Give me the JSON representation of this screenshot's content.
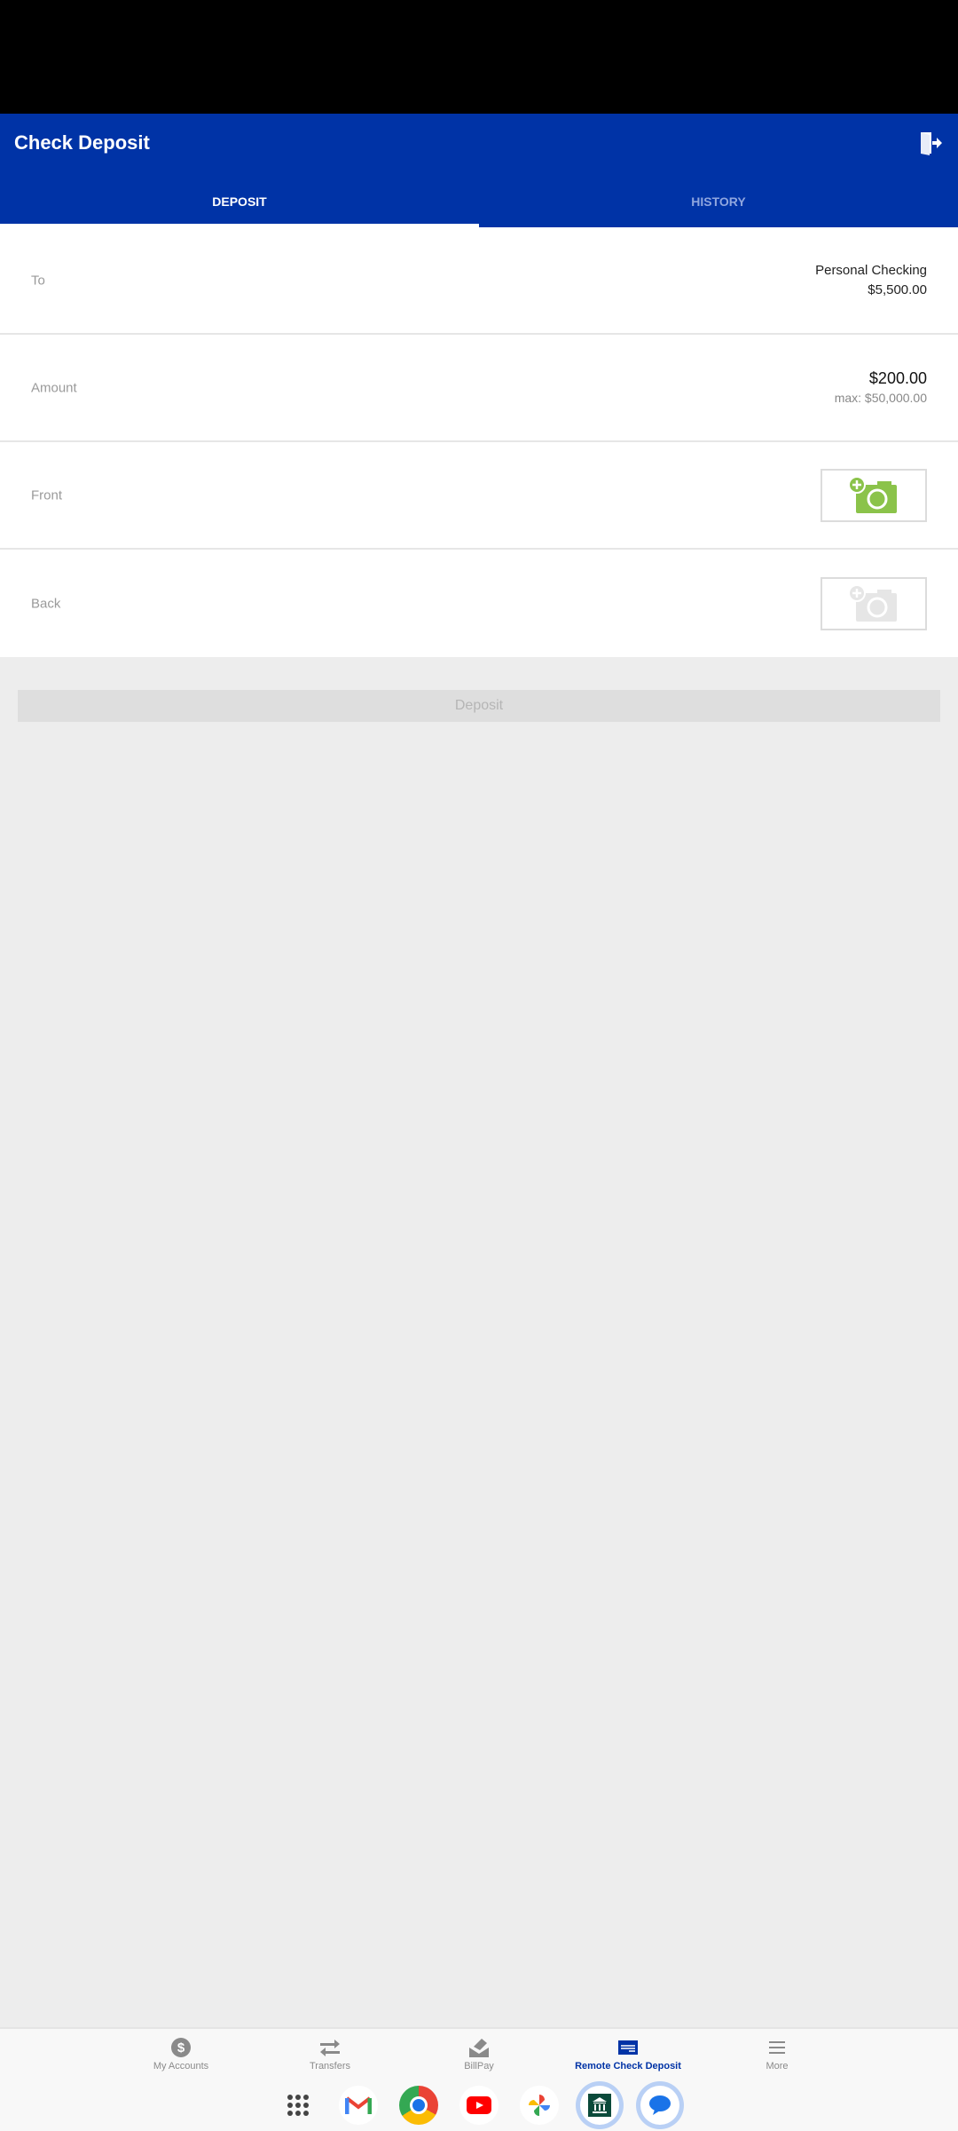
{
  "header": {
    "title": "Check Deposit",
    "tabs": [
      {
        "label": "DEPOSIT",
        "active": true
      },
      {
        "label": "HISTORY",
        "active": false
      }
    ]
  },
  "form": {
    "to": {
      "label": "To",
      "account": "Personal Checking",
      "balance": "$5,500.00"
    },
    "amount": {
      "label": "Amount",
      "value": "$200.00",
      "max": "max: $50,000.00"
    },
    "front": {
      "label": "Front",
      "state": "enabled"
    },
    "back": {
      "label": "Back",
      "state": "disabled"
    }
  },
  "deposit_button": {
    "label": "Deposit",
    "enabled": false
  },
  "bottom_nav": {
    "items": [
      {
        "label": "My Accounts",
        "icon": "dollar-icon"
      },
      {
        "label": "Transfers",
        "icon": "transfer-icon"
      },
      {
        "label": "BillPay",
        "icon": "billpay-icon"
      },
      {
        "label": "Remote Check Deposit",
        "icon": "check-icon",
        "active": true
      },
      {
        "label": "More",
        "icon": "menu-icon"
      }
    ]
  },
  "dock": {
    "apps": [
      "App Drawer",
      "Gmail",
      "Chrome",
      "YouTube",
      "Photos",
      "Bank",
      "Messages"
    ]
  },
  "colors": {
    "brand": "#0033a6",
    "camera_active": "#8bc34a",
    "camera_disabled": "#e6e6e6"
  }
}
